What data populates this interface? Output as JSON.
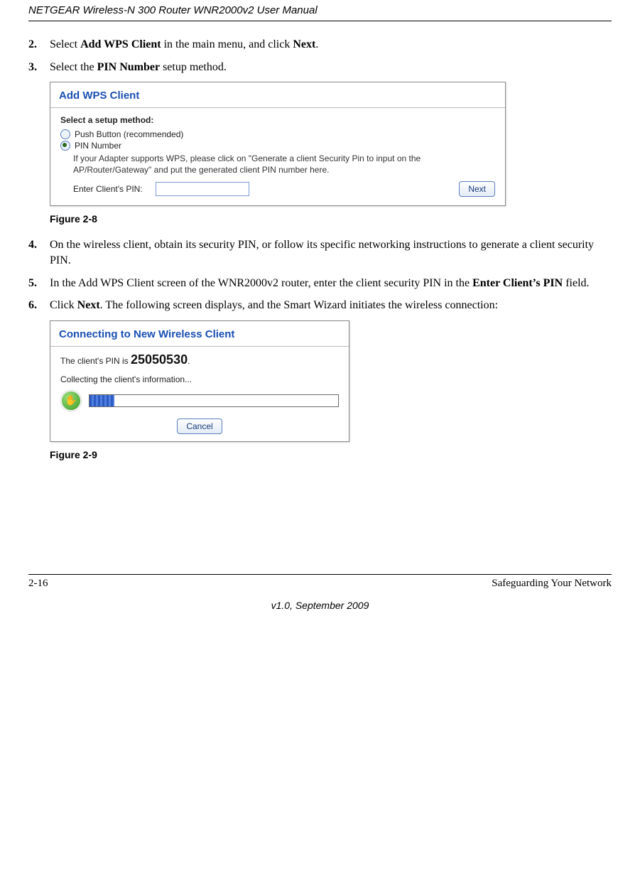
{
  "header": {
    "title": "NETGEAR Wireless-N 300 Router WNR2000v2 User Manual"
  },
  "steps": {
    "s2_num": "2.",
    "s2_a": "Select ",
    "s2_b": "Add WPS Client",
    "s2_c": " in the main menu, and click ",
    "s2_d": "Next",
    "s2_e": ".",
    "s3_num": "3.",
    "s3_a": "Select the ",
    "s3_b": "PIN Number",
    "s3_c": " setup method.",
    "s4_num": "4.",
    "s4": "On the wireless client, obtain its security PIN, or follow its specific networking instructions to generate a client security PIN.",
    "s5_num": "5.",
    "s5_a": "In the Add WPS Client screen of the WNR2000v2 router, enter the client security PIN in the ",
    "s5_b": "Enter Client’s PIN",
    "s5_c": " field.",
    "s6_num": "6.",
    "s6_a": "Click ",
    "s6_b": "Next",
    "s6_c": ". The following screen displays, and the Smart Wizard initiates the wireless connection:"
  },
  "figures": {
    "f28": "Figure 2-8",
    "f29": "Figure 2-9"
  },
  "panel1": {
    "title": "Add WPS Client",
    "select_heading": "Select a setup method:",
    "opt_push": "Push Button (recommended)",
    "opt_pin": "PIN Number",
    "help": "If your Adapter supports WPS, please click on \"Generate a client Security Pin to input on the AP/Router/Gateway\" and put the generated client PIN number here.",
    "enter_label": "Enter Client's PIN:",
    "pin_value": "",
    "next": "Next"
  },
  "panel2": {
    "title": "Connecting to New Wireless Client",
    "line_a": "The client's PIN is ",
    "pin": "25050530",
    "line_b": ".",
    "collecting": "Collecting the client's information...",
    "cancel": "Cancel"
  },
  "footer": {
    "page": "2-16",
    "section": "Safeguarding Your Network",
    "version": "v1.0, September 2009"
  }
}
